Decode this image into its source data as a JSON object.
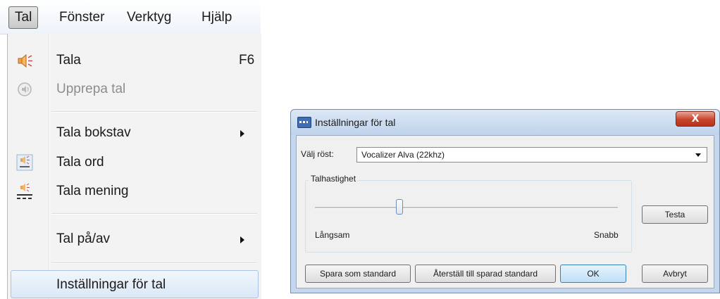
{
  "menubar": {
    "items": [
      "Tal",
      "Fönster",
      "Verktyg",
      "Hjälp"
    ]
  },
  "tal_menu": {
    "items": [
      {
        "label": "Tala",
        "shortcut": "F6",
        "icon": "speaker-icon",
        "enabled": true
      },
      {
        "label": "Upprepa tal",
        "icon": "repeat-speech-icon",
        "enabled": false
      },
      {
        "label": "Tala bokstav",
        "submenu": true,
        "enabled": true
      },
      {
        "label": "Tala ord",
        "icon": "speak-word-icon",
        "enabled": true
      },
      {
        "label": "Tala mening",
        "icon": "speak-sentence-icon",
        "enabled": true
      },
      {
        "label": "Tal på/av",
        "submenu": true,
        "enabled": true
      },
      {
        "label": "Inställningar för tal",
        "enabled": true,
        "highlighted": true
      }
    ]
  },
  "dialog": {
    "title": "Inställningar för tal",
    "close_label": "X",
    "voice_label": "Välj röst:",
    "voice_value": "Vocalizer Alva (22khz)",
    "speed_group": "Talhastighet",
    "speed_min_label": "Långsam",
    "speed_max_label": "Snabb",
    "speed_value_fraction": 0.28,
    "test_button": "Testa",
    "save_default_button": "Spara som standard",
    "restore_default_button": "Återställ till sparad standard",
    "ok_button": "OK",
    "cancel_button": "Avbryt"
  },
  "colors": {
    "accent": "#3c7fb1",
    "close_button": "#c7442c",
    "titlebar": "#c5d7ee"
  }
}
